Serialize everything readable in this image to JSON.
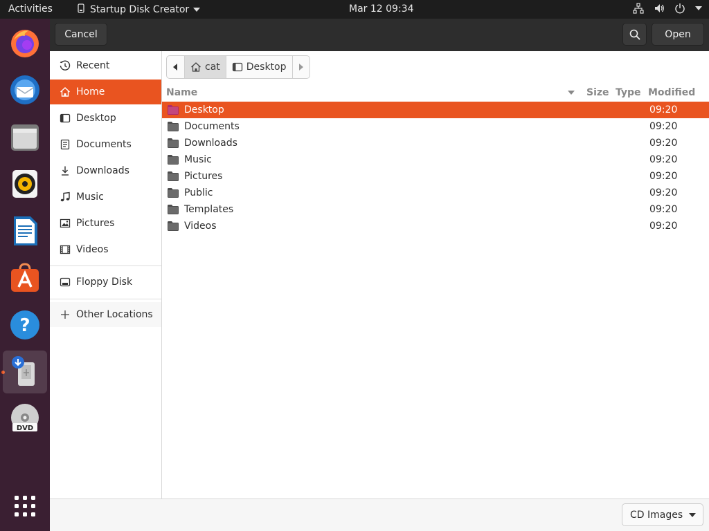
{
  "topbar": {
    "activities": "Activities",
    "app_name": "Startup Disk Creator",
    "clock": "Mar 12  09:34"
  },
  "dock": {
    "items": [
      {
        "name": "firefox-icon"
      },
      {
        "name": "thunderbird-icon"
      },
      {
        "name": "files-icon"
      },
      {
        "name": "rhythmbox-icon"
      },
      {
        "name": "libreoffice-writer-icon"
      },
      {
        "name": "software-center-icon"
      },
      {
        "name": "help-icon"
      },
      {
        "name": "startup-disk-creator-icon"
      },
      {
        "name": "dvd-icon"
      },
      {
        "name": "show-applications-icon"
      }
    ]
  },
  "header": {
    "cancel_label": "Cancel",
    "open_label": "Open"
  },
  "sidebar": {
    "items": [
      {
        "label": "Recent",
        "icon": "clock-icon"
      },
      {
        "label": "Home",
        "icon": "home-icon"
      },
      {
        "label": "Desktop",
        "icon": "desktop-icon"
      },
      {
        "label": "Documents",
        "icon": "document-icon"
      },
      {
        "label": "Downloads",
        "icon": "download-icon"
      },
      {
        "label": "Music",
        "icon": "music-icon"
      },
      {
        "label": "Pictures",
        "icon": "picture-icon"
      },
      {
        "label": "Videos",
        "icon": "video-icon"
      }
    ],
    "floppy": "Floppy Disk",
    "other": "Other Locations"
  },
  "pathbar": {
    "crumbs": [
      "cat",
      "Desktop"
    ]
  },
  "columns": {
    "name": "Name",
    "size": "Size",
    "type": "Type",
    "modified": "Modified"
  },
  "files": [
    {
      "name": "Desktop",
      "modified": "09:20"
    },
    {
      "name": "Documents",
      "modified": "09:20"
    },
    {
      "name": "Downloads",
      "modified": "09:20"
    },
    {
      "name": "Music",
      "modified": "09:20"
    },
    {
      "name": "Pictures",
      "modified": "09:20"
    },
    {
      "name": "Public",
      "modified": "09:20"
    },
    {
      "name": "Templates",
      "modified": "09:20"
    },
    {
      "name": "Videos",
      "modified": "09:20"
    }
  ],
  "filter": {
    "selected": "CD Images"
  },
  "colors": {
    "accent": "#e95420",
    "dock_bg": "#3a1f32"
  }
}
